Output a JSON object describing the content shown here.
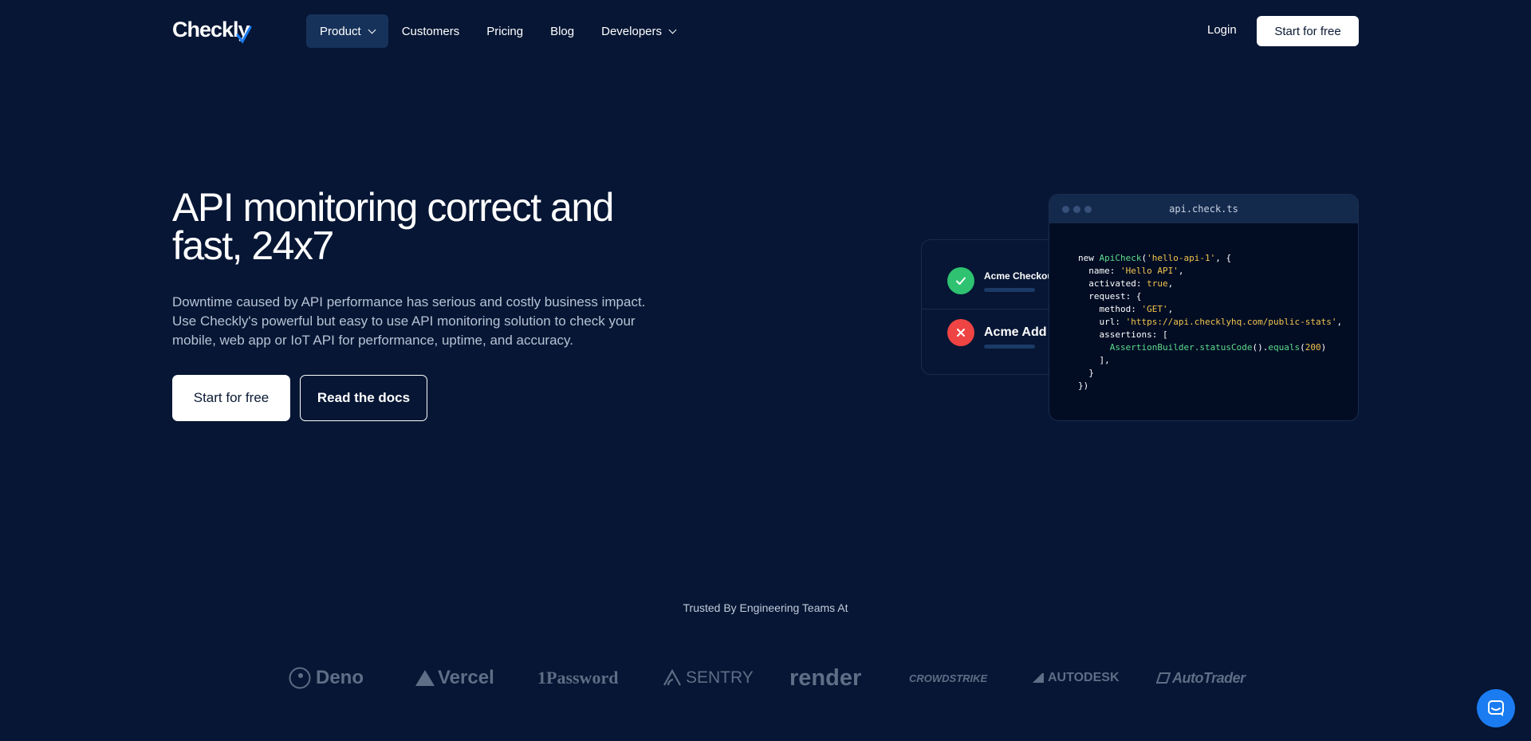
{
  "brand": {
    "name": "Checkly"
  },
  "nav": {
    "items": [
      {
        "label": "Product",
        "has_dropdown": true,
        "active": true
      },
      {
        "label": "Customers",
        "has_dropdown": false
      },
      {
        "label": "Pricing",
        "has_dropdown": false
      },
      {
        "label": "Blog",
        "has_dropdown": false
      },
      {
        "label": "Developers",
        "has_dropdown": true
      }
    ],
    "login_label": "Login",
    "cta_label": "Start for free"
  },
  "hero": {
    "title": "API monitoring correct and fast, 24x7",
    "description": "Downtime caused by API performance has serious and costly business impact. Use Checkly's powerful but easy to use API monitoring solution to check your mobile, web app or IoT API for performance, uptime, and accuracy.",
    "primary_button": "Start for free",
    "secondary_button": "Read the docs"
  },
  "status_card": {
    "checks": [
      {
        "name": "Acme Checkout",
        "status": "passing",
        "icon": "check-icon"
      },
      {
        "name": "Acme Add to cart",
        "status": "failing",
        "icon": "x-icon"
      }
    ]
  },
  "code_window": {
    "filename": "api.check.ts",
    "code": {
      "l1_kw": "new ",
      "l1_cls": "ApiCheck",
      "l1_open": "(",
      "l1_str": "'hello-api-1'",
      "l1_end": ", {",
      "l2_key": "  name: ",
      "l2_str": "'Hello API'",
      "l2_end": ",",
      "l3_key": "  activated: ",
      "l3_val": "true",
      "l3_end": ",",
      "l4": "  request: {",
      "l5_key": "    method: ",
      "l5_str": "'GET'",
      "l5_end": ",",
      "l6_key": "    url: ",
      "l6_str": "'https://api.checklyhq.com/public-stats'",
      "l6_end": ",",
      "l7": "    assertions: [",
      "l8_cls": "      AssertionBuilder.statusCode",
      "l8_mid": "().",
      "l8_fn": "equals",
      "l8_open": "(",
      "l8_num": "200",
      "l8_close": ")",
      "l9": "    ],",
      "l10": "  }",
      "l11": "})"
    },
    "colors": {
      "class": "#5ddc8b",
      "string": "#f2c44d",
      "plain": "#ffffff"
    }
  },
  "trusted": {
    "heading": "Trusted By Engineering Teams At",
    "logos": [
      "Deno",
      "Vercel",
      "1Password",
      "SENTRY",
      "render",
      "CROWDSTRIKE",
      "AUTODESK",
      "AutoTrader"
    ]
  },
  "chat": {
    "icon": "chat-icon"
  }
}
